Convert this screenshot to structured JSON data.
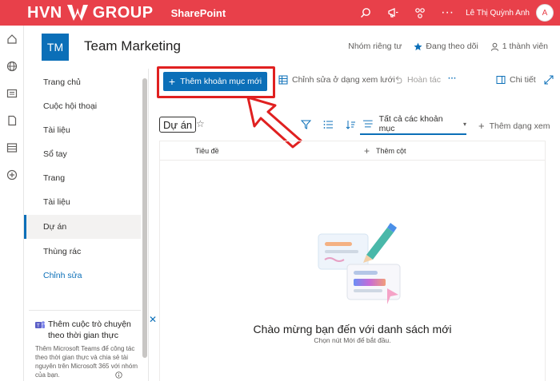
{
  "topbar": {
    "brand_left": "HVN",
    "brand_right": "GROUP",
    "app_name": "SharePoint",
    "user_name": "Lê Thị Quỳnh Anh",
    "avatar_initial": "A",
    "more": "···"
  },
  "site": {
    "logo_initials": "TM",
    "title": "Team Marketing",
    "privacy": "Nhóm riêng tư",
    "following": "Đang theo dõi",
    "members": "1 thành viên"
  },
  "nav": {
    "items": [
      {
        "label": "Trang chủ"
      },
      {
        "label": "Cuộc hội thoại"
      },
      {
        "label": "Tài liệu"
      },
      {
        "label": "Sổ tay"
      },
      {
        "label": "Trang"
      },
      {
        "label": "Tài liệu"
      },
      {
        "label": "Dự án"
      },
      {
        "label": "Thùng rác"
      }
    ],
    "edit_label": "Chỉnh sửa"
  },
  "teams_card": {
    "title": "Thêm cuộc trò chuyện theo thời gian thực",
    "body": "Thêm Microsoft Teams để công tác theo thời gian thực và chia sẻ tài nguyên trên Microsoft 365 với nhóm của bạn."
  },
  "cmdbar": {
    "new_item": "Thêm khoản mục mới",
    "grid_edit": "Chỉnh sửa ở dạng xem lưới",
    "undo": "Hoàn tác",
    "more": "···",
    "details": "Chi tiết"
  },
  "list": {
    "title": "Dự án",
    "view_name": "Tất cả các khoản mục",
    "add_view": "Thêm dạng xem",
    "col_title": "Tiêu đề",
    "add_column": "Thêm cột",
    "empty_title": "Chào mừng bạn đến với danh sách mới",
    "empty_sub": "Chọn nút Mới để bắt đầu."
  },
  "colors": {
    "topbar": "#e8404a",
    "accent": "#0b6fb8",
    "highlight": "#e02020"
  }
}
